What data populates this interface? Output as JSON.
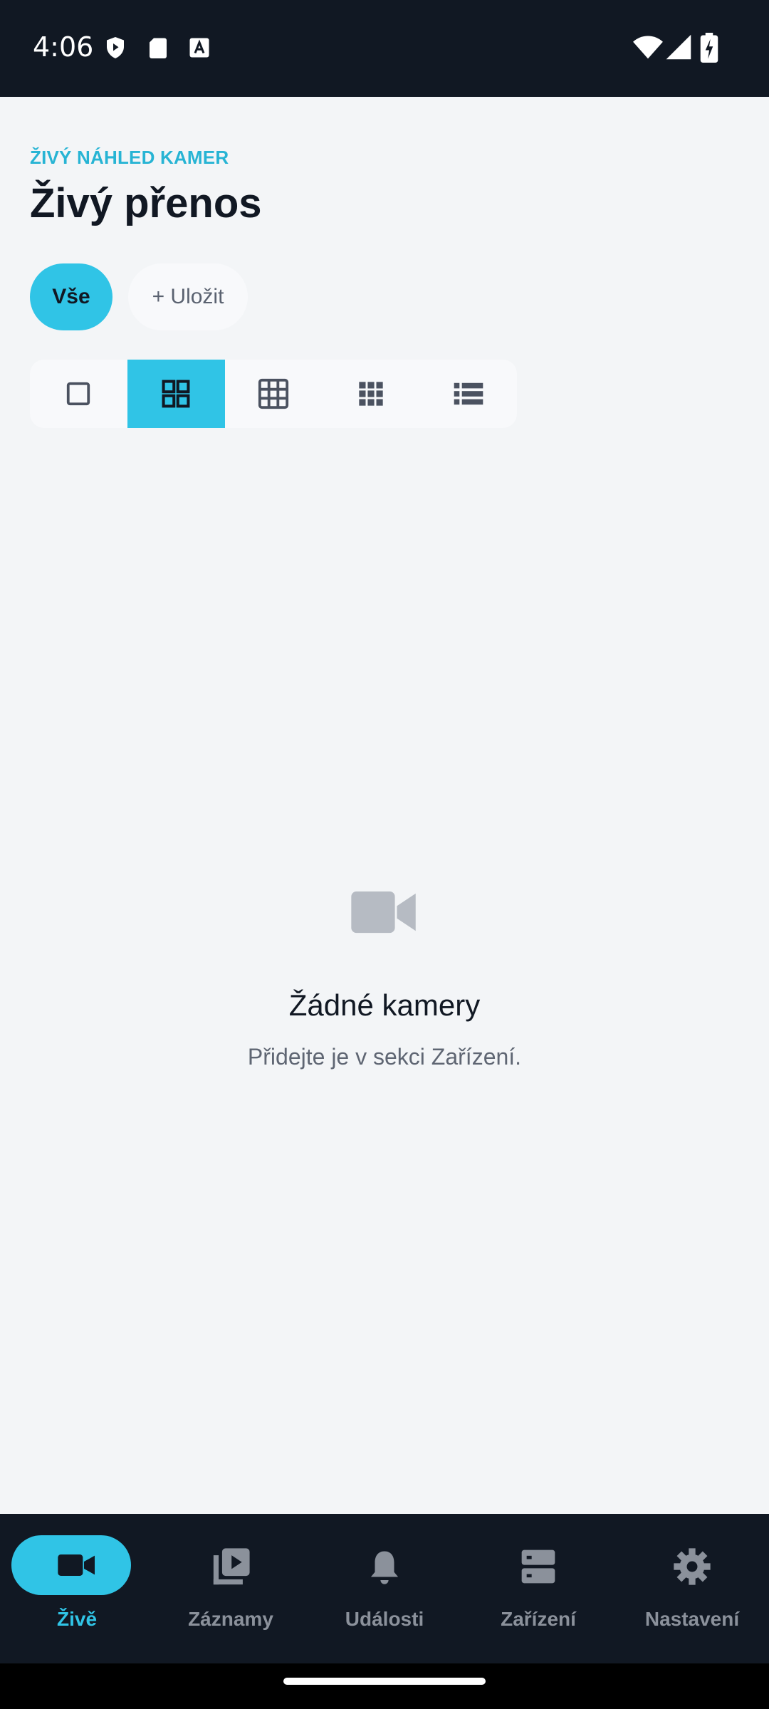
{
  "status_bar": {
    "time": "4:06",
    "icons_left": [
      "shield-icon",
      "sd-card-icon",
      "font-a-icon"
    ],
    "icons_right": [
      "wifi-icon",
      "signal-icon",
      "battery-charging-icon"
    ]
  },
  "header": {
    "eyebrow": "ŽIVÝ NÁHLED KAMER",
    "title": "Živý přenos"
  },
  "filters": {
    "all_label": "Vše",
    "save_label": "+ Uložit"
  },
  "layout_options": {
    "items": [
      "single-view-icon",
      "grid-2x2-icon",
      "grid-3x3-icon",
      "grid-4x4-icon",
      "list-view-icon"
    ],
    "selected": "grid-2x2-icon"
  },
  "empty_state": {
    "icon": "video-camera-icon",
    "title": "Žádné kamery",
    "subtitle": "Přidejte je v sekci Zařízení."
  },
  "bottom_nav": {
    "items": [
      {
        "label": "Živě",
        "icon": "video-camera-icon",
        "active": true
      },
      {
        "label": "Záznamy",
        "icon": "recordings-icon",
        "active": false
      },
      {
        "label": "Události",
        "icon": "bell-icon",
        "active": false
      },
      {
        "label": "Zařízení",
        "icon": "devices-icon",
        "active": false
      },
      {
        "label": "Nastavení",
        "icon": "gear-icon",
        "active": false
      }
    ]
  },
  "colors": {
    "accent": "#30c4e6",
    "eyebrow": "#27b4d4",
    "dark": "#111823",
    "background": "#f3f5f7"
  }
}
